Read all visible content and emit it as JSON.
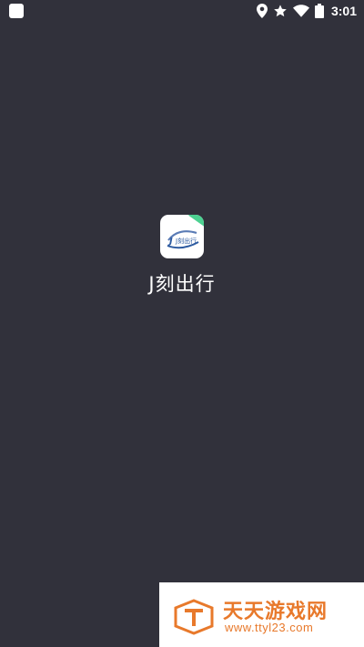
{
  "status_bar": {
    "time": "3:01",
    "icons": [
      "notification-square-icon",
      "location-icon",
      "star-icon",
      "wifi-icon",
      "battery-icon"
    ],
    "text_color": "#ffffff"
  },
  "app": {
    "name": "J刻出行",
    "icon_text": "J刻出行"
  },
  "watermark": {
    "title": "天天游戏网",
    "url": "www.ttyl23.com",
    "color": "#e8792b"
  },
  "colors": {
    "background": "#31313b",
    "badge": "#4cd191"
  }
}
